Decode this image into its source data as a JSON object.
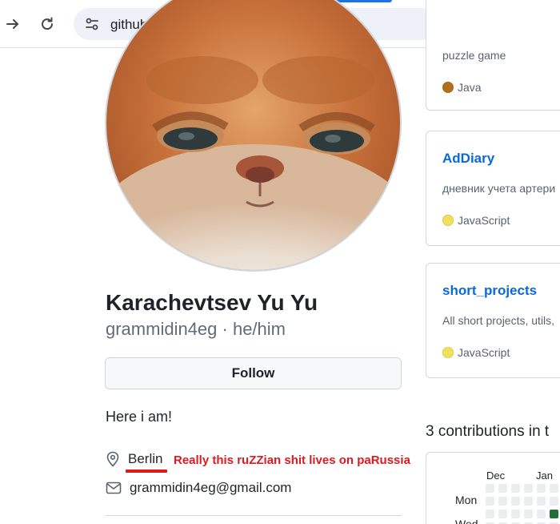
{
  "browser": {
    "url": "github.com/grammidin4eg",
    "back_icon": "arrow-right-icon",
    "reload_icon": "reload-icon",
    "site_info_icon": "tune-icon"
  },
  "profile": {
    "full_name": "Karachevtsev Yu Yu",
    "login_line": "grammidin4eg · he/him",
    "follow_label": "Follow",
    "bio": "Here i am!",
    "location": "Berlin",
    "email": "grammidin4eg@gmail.com",
    "annotation": "Really this ruZZian shit lives on paRussia",
    "annotation_color": "#e0191f"
  },
  "repos": [
    {
      "name": "",
      "description": "puzzle game",
      "language": "Java",
      "language_color": "#b07219"
    },
    {
      "name": "AdDiary",
      "description": "дневник учета артери",
      "language": "JavaScript",
      "language_color": "#f1e05a"
    },
    {
      "name": "short_projects",
      "description": "All short projects, utils,",
      "language": "JavaScript",
      "language_color": "#f1e05a"
    }
  ],
  "contributions": {
    "title": "3 contributions in t",
    "months": [
      "Dec",
      "Jan"
    ],
    "days": [
      "Mon",
      "Wed"
    ],
    "accent_color": "#216e39"
  }
}
